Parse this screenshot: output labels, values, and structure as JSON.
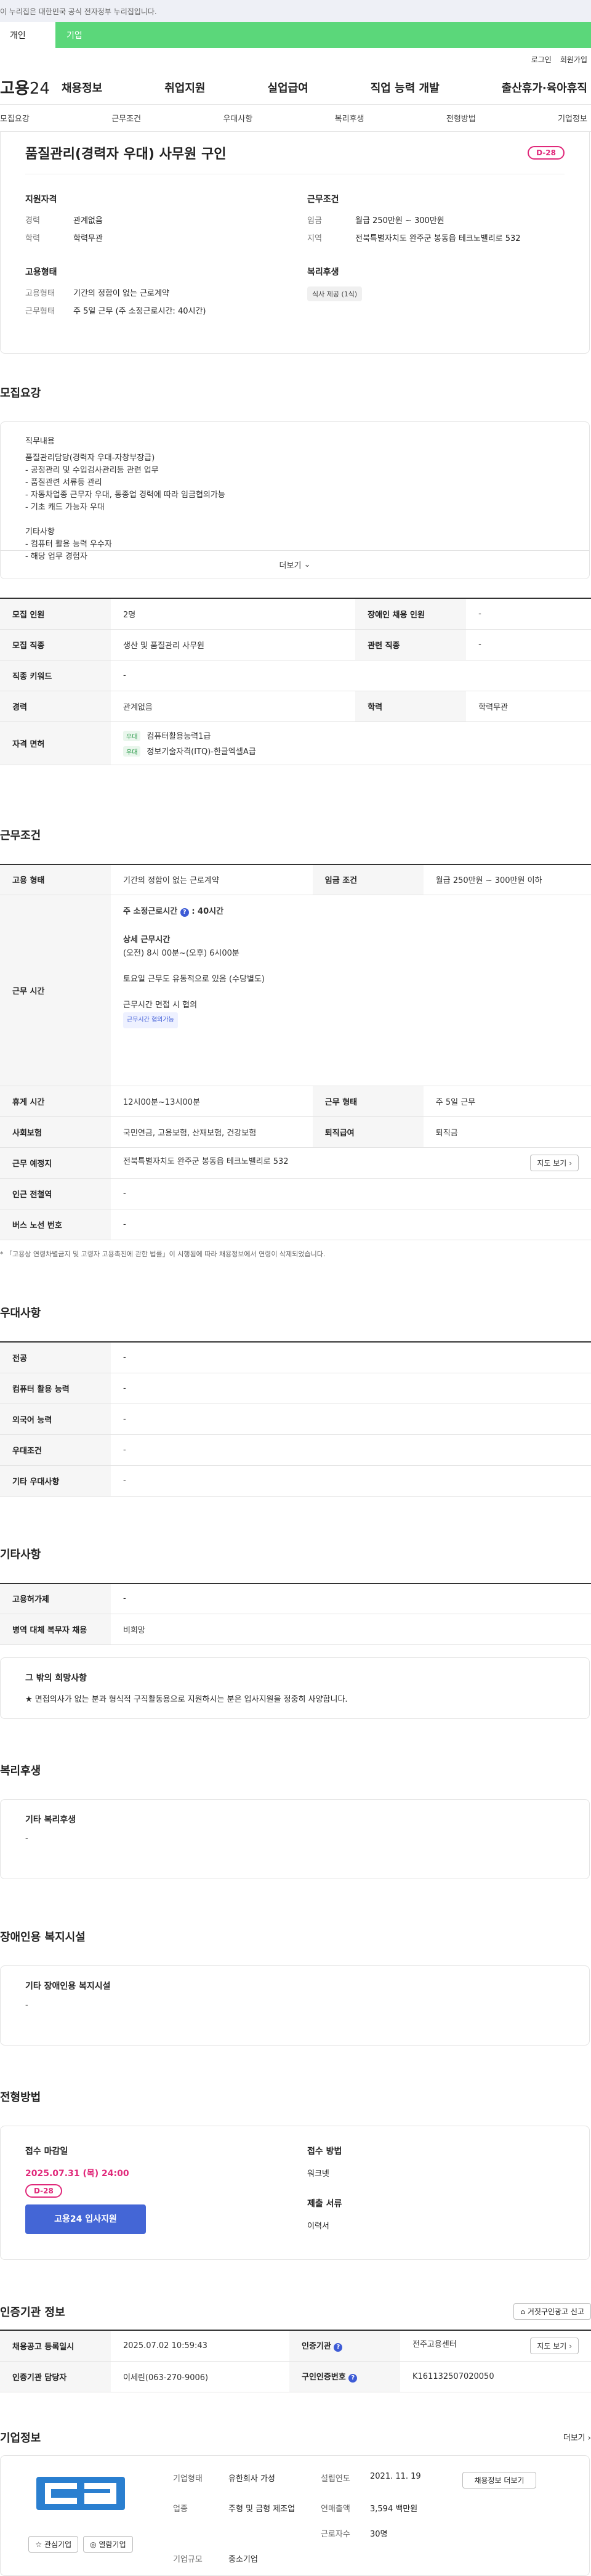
{
  "topbar": {
    "text": "이 누리집은 대한민국 공식 전자정부 누리집입니다."
  },
  "roles": {
    "personal": "개인",
    "company": "기업"
  },
  "util": {
    "login": "로그인",
    "signup": "회원가입"
  },
  "nav": {
    "logo_prefix": "고용",
    "logo_suffix": "24",
    "items": [
      "채용정보",
      "취업지원",
      "실업급여",
      "직업 능력 개발",
      "출산휴가·육아휴직"
    ]
  },
  "tabs": [
    "모집요강",
    "근무조건",
    "우대사항",
    "복리후생",
    "전형방법",
    "기업정보"
  ],
  "job": {
    "title": "품질관리(경력자 우대) 사무원 구인",
    "dday": "D-28",
    "qual": {
      "title": "지원자격",
      "rows": [
        {
          "k": "경력",
          "v": "관계없음"
        },
        {
          "k": "학력",
          "v": "학력무관"
        }
      ]
    },
    "cond": {
      "title": "근무조건",
      "rows": [
        {
          "k": "임금",
          "v": "월급 250만원 ~ 300만원"
        },
        {
          "k": "지역",
          "v": "전북특별자치도 완주군 봉동읍 테크노밸리로 532"
        }
      ]
    },
    "emp": {
      "title": "고용형태",
      "rows": [
        {
          "k": "고용형태",
          "v": "기간의 정함이 없는 근로계약"
        },
        {
          "k": "근무형태",
          "v": "주 5일 근무 (주 소정근로시간: 40시간)"
        }
      ]
    },
    "welfare": {
      "title": "복리후생",
      "chip": "식사 제공 (1식)"
    }
  },
  "recruit": {
    "title": "모집요강",
    "detail_label": "직무내용",
    "detail": "품질관리담당(경력자 우대-자창부장급)\n- 공정관리 및 수입검사관리등 관련 업무\n- 품질관련 서류등 관리\n- 자동차업종 근무자 우대, 동종업 경력에 따라 임금협의가능\n- 기초 캐드 가능자 우대\n\n기타사항\n- 컴퓨터 활용 능력 우수자\n- 해당 업무 경험자",
    "more": "더보기",
    "r1": {
      "k1": "모집 인원",
      "v1": "2명",
      "k2": "장애인 채용 인원",
      "v2": "-"
    },
    "r2": {
      "k1": "모집 직종",
      "v1": "생산 및 품질관리 사무원",
      "k2": "관련 직종",
      "v2": "-"
    },
    "r3": {
      "k1": "직종 키워드",
      "v1": "-"
    },
    "r4": {
      "k1": "경력",
      "v1": "관계없음",
      "k2": "학력",
      "v2": "학력무관"
    },
    "r5": {
      "k1": "자격 면허",
      "tag": "우대",
      "lic1": "컴퓨터활용능력1급",
      "lic2": "정보기술자격(ITQ)-한글엑셀A급"
    }
  },
  "work": {
    "title": "근무조건",
    "r1": {
      "k1": "고용 형태",
      "v1": "기간의 정함이 없는 근로계약",
      "k2": "임금 조건",
      "v2": "월급 250만원 ~ 300만원 이하"
    },
    "hours": {
      "k": "근무 시간",
      "weekly": "주 소정근로시간",
      "weekly_val": ": 40시간",
      "detail_title": "상세 근무시간",
      "time": "(오전) 8시 00분~(오후) 6시00분",
      "sat": "토요일 근무도 유동적으로 있음 (수당별도)",
      "interview": "근무시간 면접 시 협의",
      "badge": "근무시간 협의가능"
    },
    "r2": {
      "k1": "휴게 시간",
      "v1": "12시00분~13시00분",
      "k2": "근무 형태",
      "v2": "주 5일 근무"
    },
    "r3": {
      "k1": "사회보험",
      "v1": "국민연금, 고용보험, 산재보험, 건강보험",
      "k2": "퇴직급여",
      "v2": "퇴직금"
    },
    "r4": {
      "k1": "근무 예정지",
      "v1": "전북특별자치도 완주군 봉동읍 테크노밸리로 532",
      "btn": "지도 보기"
    },
    "r5": {
      "k1": "인근 전철역",
      "v1": "-"
    },
    "r6": {
      "k1": "버스 노선 번호",
      "v1": "-"
    },
    "note": "* 「고용상 연령차별금지 및 고령자 고용촉진에 관한 법률」이 시행됨에 따라 채용정보에서 연령이 삭제되었습니다."
  },
  "pref": {
    "title": "우대사항",
    "rows": [
      {
        "k": "전공",
        "v": "-"
      },
      {
        "k": "컴퓨터 활용 능력",
        "v": "-"
      },
      {
        "k": "외국어 능력",
        "v": "-"
      },
      {
        "k": "우대조건",
        "v": "-"
      },
      {
        "k": "기타 우대사항",
        "v": "-"
      }
    ]
  },
  "etc": {
    "title": "기타사항",
    "rows": [
      {
        "k": "고용허가제",
        "v": "-"
      },
      {
        "k": "병역 대체 복무자 채용",
        "v": "비희망"
      }
    ],
    "box_title": "그 밖의 희망사항",
    "box_text": "★ 면접의사가 없는 분과 형식적 구직활동용으로 지원하시는 분은 입사지원을 정중히 사양합니다."
  },
  "benefit": {
    "title": "복리후생",
    "box_title": "기타 복리후생",
    "box_text": "-"
  },
  "disab": {
    "title": "장애인용 복지시설",
    "box_title": "기타 장애인용 복지시설",
    "box_text": "-"
  },
  "apply": {
    "title": "전형방법",
    "deadline_title": "접수 마감일",
    "deadline": "2025.07.31 (목) 24:00",
    "dday": "D-28",
    "btn": "고용24 입사지원",
    "method_title": "접수 방법",
    "method": "워크넷",
    "docs_title": "제출 서류",
    "docs": "이력서"
  },
  "cert": {
    "title": "인증기관 정보",
    "report": "거짓구인광고 신고",
    "r1": {
      "k1": "채용공고 등록일시",
      "v1": "2025.07.02 10:59:43",
      "k2": "인증기관",
      "v2": "전주고용센터",
      "btn": "지도 보기"
    },
    "r2": {
      "k1": "인증기관 담당자",
      "v1": "이세린(063-270-9006)",
      "k2": "구인인증번호",
      "v2": "K161132507020050"
    }
  },
  "company": {
    "title": "기업정보",
    "more": "더보기",
    "fav": "관심기업",
    "follow": "열람기업",
    "btn": "채용정보 더보기",
    "k_type": "기업형태",
    "v_type": "유한회사 가성",
    "k_year": "설립연도",
    "v_year": "2021. 11. 19",
    "k_biz": "업종",
    "v_biz": "주형 및 금형 제조업",
    "k_sales": "연매출액",
    "v_sales": "3,594 백만원",
    "k_emp": "근로자수",
    "v_emp": "30명",
    "k_size": "기업규모",
    "v_size": "중소기업"
  }
}
